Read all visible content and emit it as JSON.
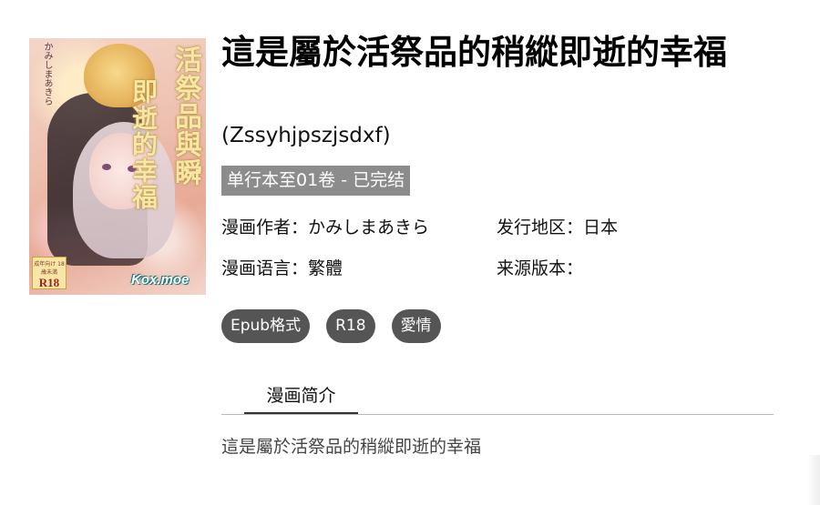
{
  "cover": {
    "title_line1": "活祭品與瞬",
    "title_line2": "即逝的幸福",
    "author": "かみしまあきら",
    "rating_note": "成年向け 18歳未満",
    "rating": "R18",
    "brand": "Kox.moe"
  },
  "title": "這是屬於活祭品的稍縱即逝的幸福",
  "subtitle": "(Zssyhjpszjsdxf)",
  "status": "单行本至01卷 - 已完结",
  "meta": {
    "author_label": "漫画作者：",
    "author_value": "かみしまあきら",
    "region_label": "发行地区：",
    "region_value": "日本",
    "language_label": "漫画语言：",
    "language_value": "繁體",
    "source_label": "来源版本：",
    "source_value": ""
  },
  "tags": [
    "Epub格式",
    "R18",
    "愛情"
  ],
  "tabs": {
    "intro": "漫画简介"
  },
  "description": "這是屬於活祭品的稍縱即逝的幸福",
  "colors": {
    "status_bg": "#8c8c8c",
    "tag_bg": "#555555",
    "text": "#111111"
  }
}
